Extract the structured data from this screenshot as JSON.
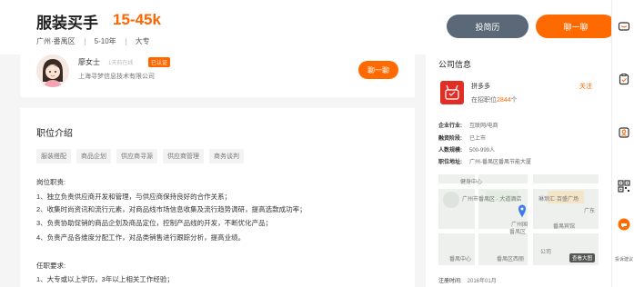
{
  "job": {
    "title": "服装买手",
    "salary": "15-45k",
    "location": "广州·番禺区",
    "experience": "5-10年",
    "education": "大专"
  },
  "actions": {
    "resume_label": "投简历",
    "chat_label": "聊一聊"
  },
  "recruiter": {
    "name": "廖女士",
    "active": "1天前在线",
    "badge": "已认证",
    "company": "上海寻梦信息技术有限公司",
    "chat_label": "聊一聊"
  },
  "description": {
    "heading": "职位介绍",
    "tags": [
      "服装搭配",
      "商品企划",
      "供应商寻源",
      "供应商管理",
      "商务谈判"
    ],
    "duties_title": "岗位职责:",
    "duties": [
      "1、独立负责供应商开发和管理，与供应商保持良好的合作关系；",
      "2、收集时尚资讯和流行元素，对商品线市场信息收集及流行趋势调研，提高选款成功率；",
      "3、负责协助促销的商品企划及商品定位，控制产品线的开发，不断优化产品；",
      "4、负责产品各维度分配工作，对品类销售进行跟踪分析，提高业绩。"
    ],
    "requirements_title": "任职要求:",
    "requirements": [
      "1、大专或以上学历，3年以上相关工作经验；"
    ]
  },
  "company": {
    "heading": "公司信息",
    "name": "拼多多",
    "jobs_prefix": "在招职位",
    "jobs_count": "2844",
    "jobs_suffix": "个",
    "follow_label": "关注",
    "info": [
      {
        "key": "企业行业:",
        "value": "互联网/电商"
      },
      {
        "key": "融资阶段:",
        "value": "已上市"
      },
      {
        "key": "人数规模:",
        "value": "500-999人"
      },
      {
        "key": "职位地址:",
        "value": "广州-番禺区番禺节能大厦"
      }
    ],
    "map_labels": [
      "健身中心",
      "广州市番禺区 · 大道酒店",
      "琳琅汇·百盛广场",
      "广州国",
      "番禺区",
      "番禺宾馆",
      "广东",
      "公司",
      "番禺中心",
      "番禺区西丽"
    ],
    "map_button": "查看大图",
    "registered_key": "注册时间:",
    "registered_value": "2016年01月"
  },
  "toolbar": {
    "feedback_label": "投诉建议"
  },
  "colors": {
    "accent": "#ff6a00",
    "salary": "#ff6600",
    "secondary_button": "#5a6878",
    "brand_logo": "#e02e24"
  }
}
